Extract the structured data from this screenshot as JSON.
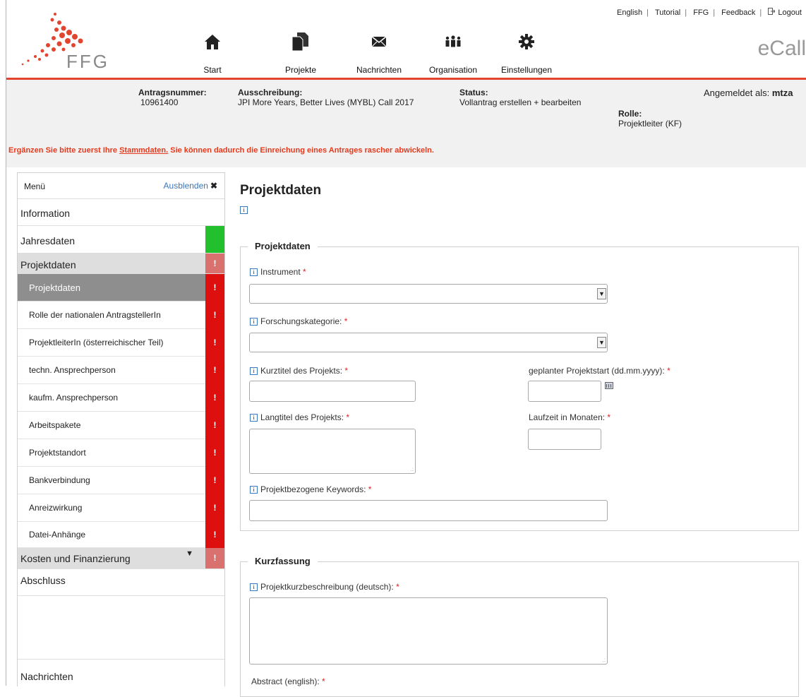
{
  "header": {
    "links": [
      "English",
      "Tutorial",
      "FFG",
      "Feedback",
      "Logout"
    ],
    "logo_text": "FFG",
    "app_name": "eCall",
    "nav": [
      {
        "label": "Start",
        "icon": "home-icon"
      },
      {
        "label": "Projekte",
        "icon": "documents-icon"
      },
      {
        "label": "Nachrichten",
        "icon": "envelope-icon"
      },
      {
        "label": "Organisation",
        "icon": "people-icon"
      },
      {
        "label": "Einstellungen",
        "icon": "gear-icon"
      }
    ]
  },
  "info": {
    "antrag_label": "Antragsnummer:",
    "antrag_value": "10961400",
    "ausschreibung_label": "Ausschreibung:",
    "ausschreibung_value": "JPI More Years, Better Lives (MYBL) Call 2017",
    "status_label": "Status:",
    "status_value": "Vollantrag erstellen + bearbeiten",
    "angemeldet_label": "Angemeldet als:",
    "angemeldet_value": "mtza",
    "rolle_label": "Rolle:",
    "rolle_value": "Projektleiter (KF)",
    "notice_before": "Ergänzen Sie bitte zuerst Ihre ",
    "notice_link": "Stammdaten.",
    "notice_after": " Sie können dadurch die Einreichung eines Antrages rascher abwickeln."
  },
  "sidebar": {
    "title": "Menü",
    "hide_label": "Ausblenden",
    "items": [
      "Information",
      "Jahresdaten",
      "Projektdaten",
      "Projektdaten",
      "Rolle der nationalen AntragstellerIn",
      "ProjektleiterIn (österreichischer Teil)",
      "techn. Ansprechperson",
      "kaufm. Ansprechperson",
      "Arbeitspakete",
      "Projektstandort",
      "Bankverbindung",
      "Anreizwirkung",
      "Datei-Anhänge",
      "Kosten und Finanzierung",
      "Abschluss",
      "Nachrichten"
    ],
    "flag_mark": "!"
  },
  "main": {
    "title": "Projektdaten",
    "info_mark": "i",
    "section1": {
      "legend": "Projektdaten",
      "instrument": "Instrument",
      "forschung": "Forschungskategorie:",
      "kurztitel": "Kurztitel des Projekts:",
      "projektstart": "geplanter Projektstart (dd.mm.yyyy):",
      "langtitel": "Langtitel des Projekts:",
      "laufzeit": "Laufzeit in Monaten:",
      "keywords": "Projektbezogene Keywords:"
    },
    "section2": {
      "legend": "Kurzfassung",
      "kurzbeschreibung": "Projektkurzbeschreibung (deutsch):",
      "abstract": "Abstract (english):"
    },
    "required_mark": "*"
  },
  "colors": {
    "accent_red": "#e2442f",
    "flag_red": "#dd0f0f",
    "flag_green": "#22c02d",
    "link_blue": "#3a76b5"
  }
}
